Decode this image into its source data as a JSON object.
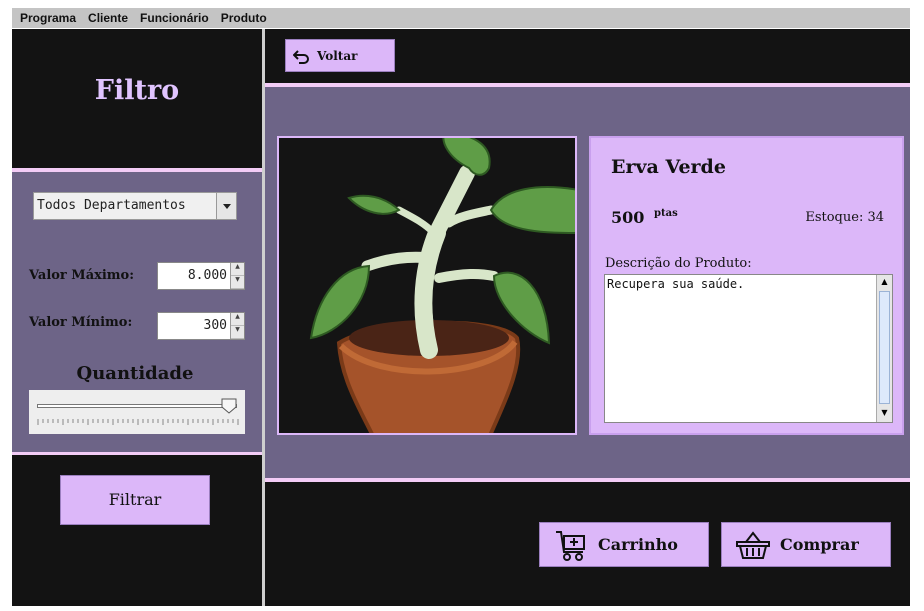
{
  "menu": [
    "Programa",
    "Cliente",
    "Funcionário",
    "Produto"
  ],
  "sidebar": {
    "title": "Filtro",
    "department": "Todos Departamentos",
    "max_label": "Valor Máximo:",
    "max_value": "8.000",
    "min_label": "Valor Mínimo:",
    "min_value": "300",
    "quantity_label": "Quantidade",
    "quantity_level": 1.0,
    "filter_button": "Filtrar"
  },
  "toolbar": {
    "back_label": "Voltar"
  },
  "product": {
    "name": "Erva Verde",
    "price": "500",
    "currency": "ptas",
    "stock": "Estoque: 34",
    "desc_label": "Descrição do Produto:",
    "description": "Recupera sua saúde."
  },
  "actions": {
    "cart_label": "Carrinho",
    "buy_label": "Comprar"
  },
  "colors": {
    "panel_dark": "#131313",
    "panel_purple": "#6d6487",
    "lilac": "#dcb7f9",
    "title": "#e0c4ff"
  }
}
